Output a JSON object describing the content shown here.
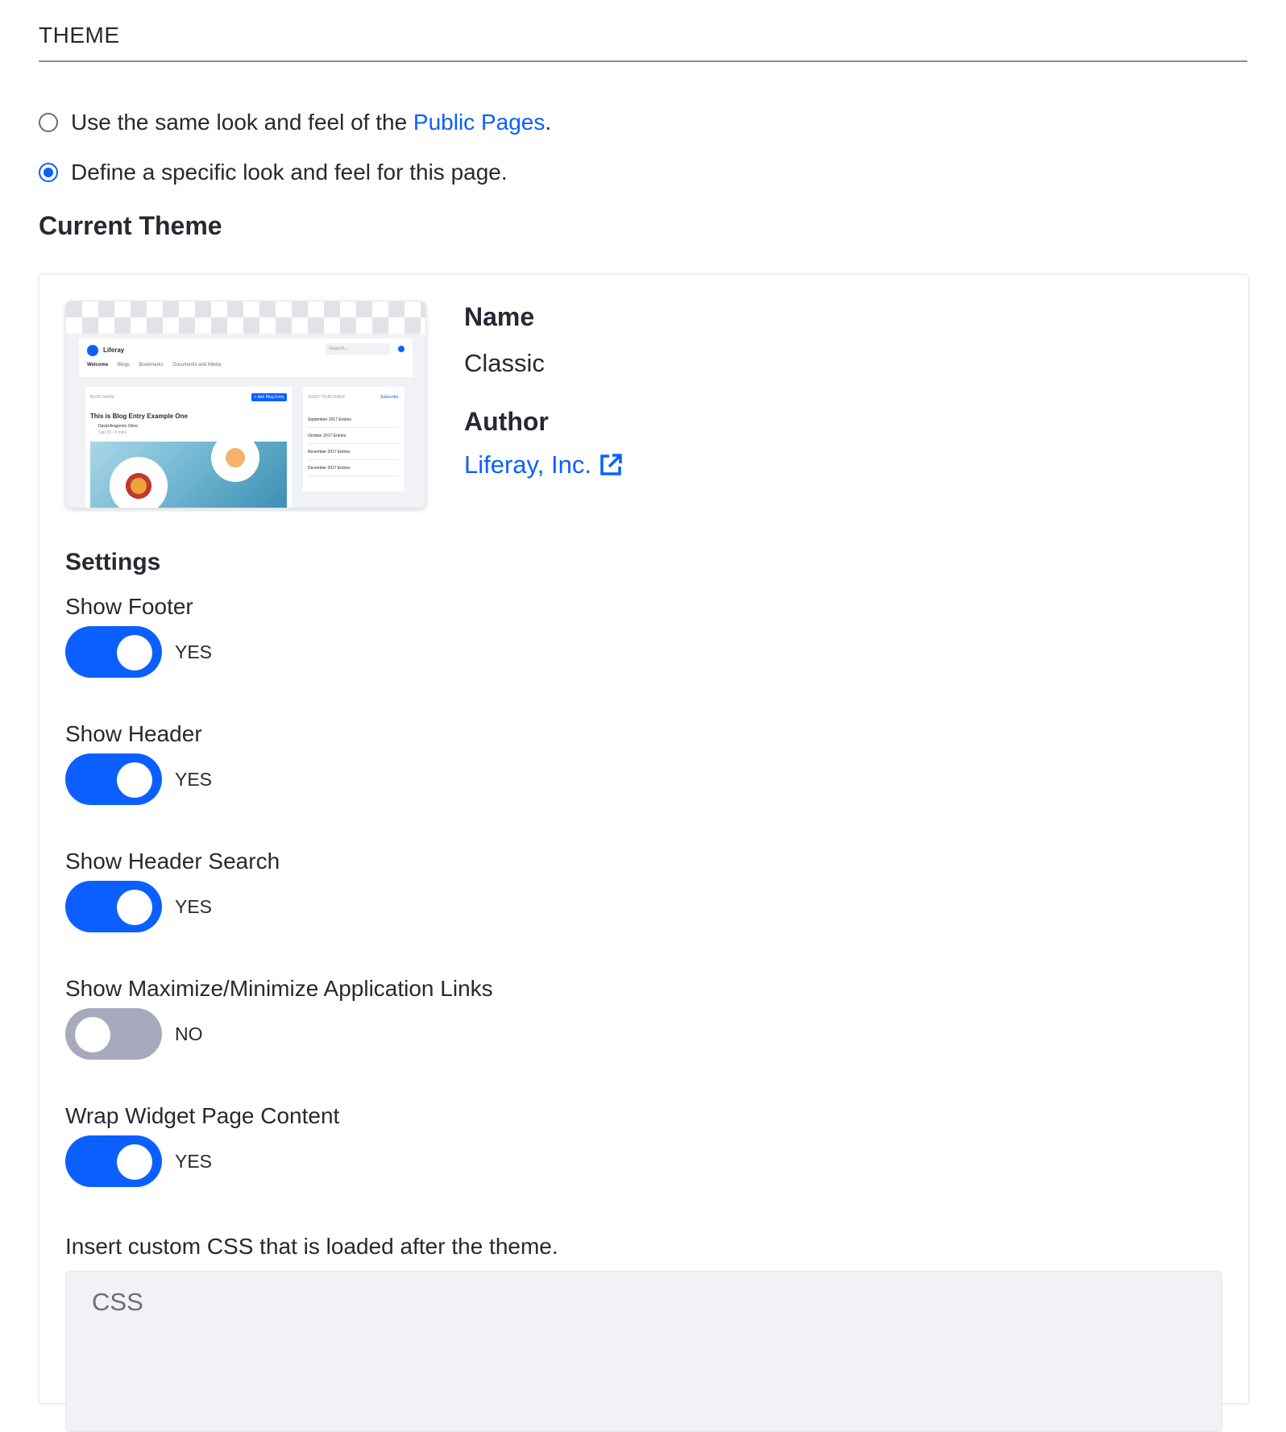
{
  "section": {
    "title": "THEME"
  },
  "look_and_feel": {
    "option_public": {
      "prefix": "Use the same look and feel of the ",
      "link": "Public Pages",
      "suffix": ".",
      "checked": false
    },
    "option_specific": {
      "label": "Define a specific look and feel for this page.",
      "checked": true
    }
  },
  "current_theme": {
    "heading": "Current Theme",
    "name_label": "Name",
    "name_value": "Classic",
    "author_label": "Author",
    "author_value": "Liferay, Inc.",
    "author_icon": "external-link-icon",
    "preview": {
      "brand": "Liferay",
      "search_placeholder": "Search...",
      "nav": [
        "Welcome",
        "Blogs",
        "Bookmarks",
        "Documents and Media"
      ],
      "main_label": "BLOG NAME",
      "add_button": "+ Add Blog Entry",
      "post_title": "This is Blog Entry Example One",
      "post_author": "David Aragonés Otero",
      "post_date": "Sep 20 - 8 mins",
      "side_label": "ASSET PUBLISHER",
      "side_subscribe": "Subscribe",
      "side_entries": [
        "September 2017 Entries",
        "October 2017 Entries",
        "November 2017 Entries",
        "December 2017 Entries"
      ]
    }
  },
  "settings": {
    "heading": "Settings",
    "toggles": [
      {
        "label": "Show Footer",
        "state": "YES",
        "on": true
      },
      {
        "label": "Show Header",
        "state": "YES",
        "on": true
      },
      {
        "label": "Show Header Search",
        "state": "YES",
        "on": true
      },
      {
        "label": "Show Maximize/Minimize Application Links",
        "state": "NO",
        "on": false
      },
      {
        "label": "Wrap Widget Page Content",
        "state": "YES",
        "on": true
      }
    ]
  },
  "custom_css": {
    "label": "Insert custom CSS that is loaded after the theme.",
    "placeholder": "CSS",
    "value": ""
  },
  "colors": {
    "primary": "#0b5fff",
    "switch_off": "#a7a9bc",
    "text": "#272833",
    "input_bg": "#f1f2f5"
  }
}
